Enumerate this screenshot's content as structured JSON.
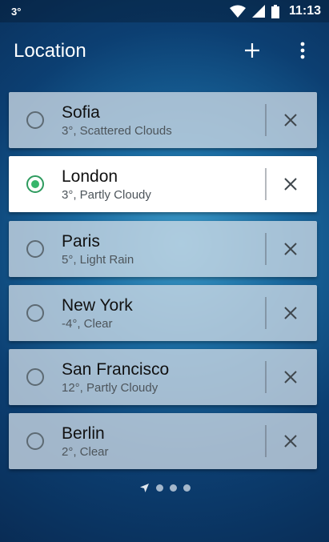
{
  "status_bar": {
    "temperature": "3°",
    "time": "11:13"
  },
  "app_bar": {
    "title": "Location",
    "add_icon": "plus-icon",
    "menu_icon": "more-vert-icon"
  },
  "colors": {
    "selected_radio": "#37b56b",
    "background_dark": "#092c55",
    "background_light": "#3b9ac8"
  },
  "locations": [
    {
      "city": "Sofia",
      "summary": "3°, Scattered Clouds",
      "selected": false
    },
    {
      "city": "London",
      "summary": "3°, Partly Cloudy",
      "selected": true
    },
    {
      "city": "Paris",
      "summary": "5°, Light Rain",
      "selected": false
    },
    {
      "city": "New York",
      "summary": "-4°, Clear",
      "selected": false
    },
    {
      "city": "San Francisco",
      "summary": "12°, Partly Cloudy",
      "selected": false
    },
    {
      "city": "Berlin",
      "summary": "2°, Clear",
      "selected": false
    }
  ],
  "pager": {
    "page_count": 3,
    "location_icon": "navigation-arrow-icon"
  }
}
